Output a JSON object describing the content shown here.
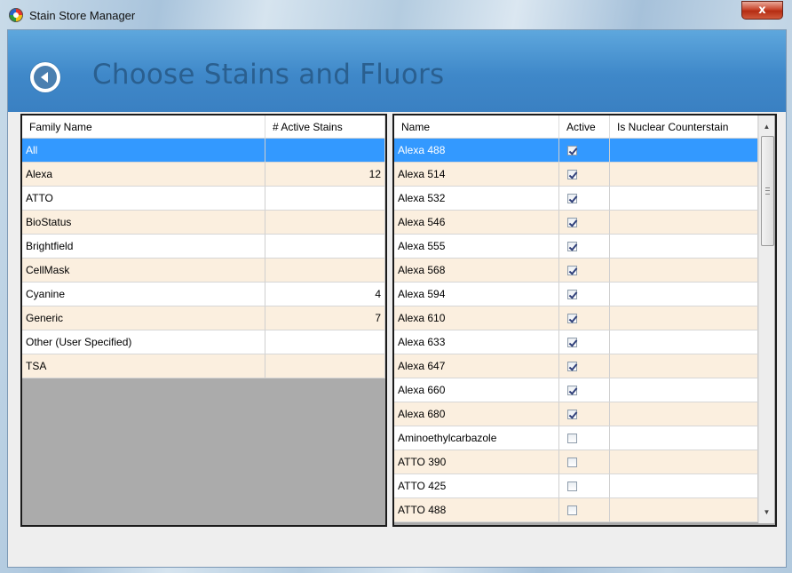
{
  "window": {
    "title": "Stain Store Manager",
    "close_label": "x"
  },
  "page": {
    "title": "Choose Stains and Fluors"
  },
  "families": {
    "columns": [
      "Family Name",
      "# Active Stains"
    ],
    "rows": [
      {
        "name": "All",
        "count": "",
        "selected": true
      },
      {
        "name": "Alexa",
        "count": "12"
      },
      {
        "name": "ATTO",
        "count": ""
      },
      {
        "name": "BioStatus",
        "count": ""
      },
      {
        "name": "Brightfield",
        "count": ""
      },
      {
        "name": "CellMask",
        "count": ""
      },
      {
        "name": "Cyanine",
        "count": "4"
      },
      {
        "name": "Generic",
        "count": "7"
      },
      {
        "name": "Other (User Specified)",
        "count": ""
      },
      {
        "name": "TSA",
        "count": ""
      }
    ]
  },
  "stains": {
    "columns": [
      "Name",
      "Active",
      "Is Nuclear Counterstain"
    ],
    "rows": [
      {
        "name": "Alexa 488",
        "active": true,
        "selected": true
      },
      {
        "name": "Alexa 514",
        "active": true
      },
      {
        "name": "Alexa 532",
        "active": true
      },
      {
        "name": "Alexa 546",
        "active": true
      },
      {
        "name": "Alexa 555",
        "active": true
      },
      {
        "name": "Alexa 568",
        "active": true
      },
      {
        "name": "Alexa 594",
        "active": true
      },
      {
        "name": "Alexa 610",
        "active": true
      },
      {
        "name": "Alexa 633",
        "active": true
      },
      {
        "name": "Alexa 647",
        "active": true
      },
      {
        "name": "Alexa 660",
        "active": true
      },
      {
        "name": "Alexa 680",
        "active": true
      },
      {
        "name": "Aminoethylcarbazole",
        "active": false
      },
      {
        "name": "ATTO 390",
        "active": false
      },
      {
        "name": "ATTO 425",
        "active": false
      },
      {
        "name": "ATTO 488",
        "active": false
      }
    ]
  },
  "colors": {
    "selection": "#3399ff",
    "alt_row": "#fbefdf",
    "header_band": "#4a90d0",
    "title_text": "#2a5f8f"
  }
}
